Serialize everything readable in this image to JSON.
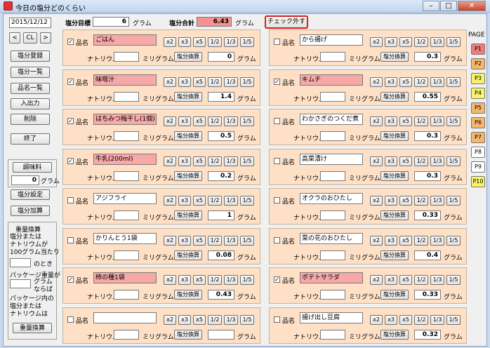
{
  "window": {
    "title": "今日の塩分どのくらい",
    "min_label": "–",
    "max_label": "□",
    "close_label": "✕"
  },
  "sidebar": {
    "date": "2015/12/12",
    "nav_prev": "<",
    "nav_cl": "CL",
    "nav_next": ">",
    "buttons": [
      "塩分登録",
      "塩分一覧",
      "品名一覧",
      "入出力",
      "削除",
      "終了"
    ],
    "seasoning_label": "調味料",
    "seasoning_value": "0",
    "gram": "グラム",
    "salt_setting": "塩分設定",
    "salt_add": "塩分加算",
    "weight_calc_title": "重量換算",
    "weight_text1": "塩分または\nナトリウムが\n100グラム当たり",
    "weight_text1_suffix": "のとき",
    "weight_text2": "パッケージ重量が",
    "weight_text2_unit": "グラム\nならば",
    "weight_text3": "パッケージ内の\n塩分または\nナトリウムは",
    "weight_calc_button": "重量換算"
  },
  "header": {
    "target_label": "塩分目標",
    "target_value": "6",
    "target_unit": "グラム",
    "total_label": "塩分合計",
    "total_value": "6.43",
    "total_unit": "グラム",
    "uncheck_button": "チェック外す"
  },
  "row_labels": {
    "hinmei": "品名",
    "sodium": "ナトリウム",
    "mg": "ミリグラム",
    "convert": "塩分換算",
    "gram": "グラム",
    "mult": [
      "x2",
      "x3",
      "x5",
      "1/2",
      "1/3",
      "1/5"
    ]
  },
  "left_items": [
    {
      "name": "ごはん",
      "checked": "✓",
      "value": "0",
      "pink": true
    },
    {
      "name": "味噌汁",
      "checked": "✓",
      "value": "1.4",
      "pink": true
    },
    {
      "name": "はちみつ梅干し(1個)",
      "checked": "✓",
      "value": "0.5",
      "pink": true
    },
    {
      "name": "牛乳(200ml)",
      "checked": "✓",
      "value": "0.2",
      "pink": true
    },
    {
      "name": "アジフライ",
      "checked": "",
      "value": "1",
      "pink": false
    },
    {
      "name": "かりんとう1袋",
      "checked": "",
      "value": "0.08",
      "pink": false
    },
    {
      "name": "柿の種1袋",
      "checked": "✓",
      "value": "0.43",
      "pink": true
    },
    {
      "name": "",
      "checked": "",
      "value": "",
      "pink": false
    }
  ],
  "right_items": [
    {
      "name": "から揚げ",
      "checked": "",
      "value": "0.3",
      "pink": false
    },
    {
      "name": "キムチ",
      "checked": "✓",
      "value": "0.55",
      "pink": true
    },
    {
      "name": "わかさぎのつくだ煮",
      "checked": "",
      "value": "0.3",
      "pink": false
    },
    {
      "name": "高菜漬け",
      "checked": "",
      "value": "0.3",
      "pink": false
    },
    {
      "name": "オクラのおひたし",
      "checked": "",
      "value": "0.33",
      "pink": false
    },
    {
      "name": "菜の花のおひたし",
      "checked": "",
      "value": "0.4",
      "pink": false
    },
    {
      "name": "ポテトサラダ",
      "checked": "✓",
      "value": "0.33",
      "pink": true
    },
    {
      "name": "揚げ出し豆腐",
      "checked": "",
      "value": "0.32",
      "pink": false
    }
  ],
  "pages": {
    "label": "PAGE",
    "items": [
      {
        "label": "P1",
        "color": "#f27a7a"
      },
      {
        "label": "P2",
        "color": "#f6b66b"
      },
      {
        "label": "P3",
        "color": "#f7f26a"
      },
      {
        "label": "P4",
        "color": "#f7f26a"
      },
      {
        "label": "P5",
        "color": "#f6b66b"
      },
      {
        "label": "P6",
        "color": "#f6b66b"
      },
      {
        "label": "P7",
        "color": "#f6b66b"
      },
      {
        "label": "P8",
        "color": "#ffffff"
      },
      {
        "label": "P9",
        "color": "#ffffff"
      },
      {
        "label": "P10",
        "color": "#f7f26a"
      }
    ]
  }
}
